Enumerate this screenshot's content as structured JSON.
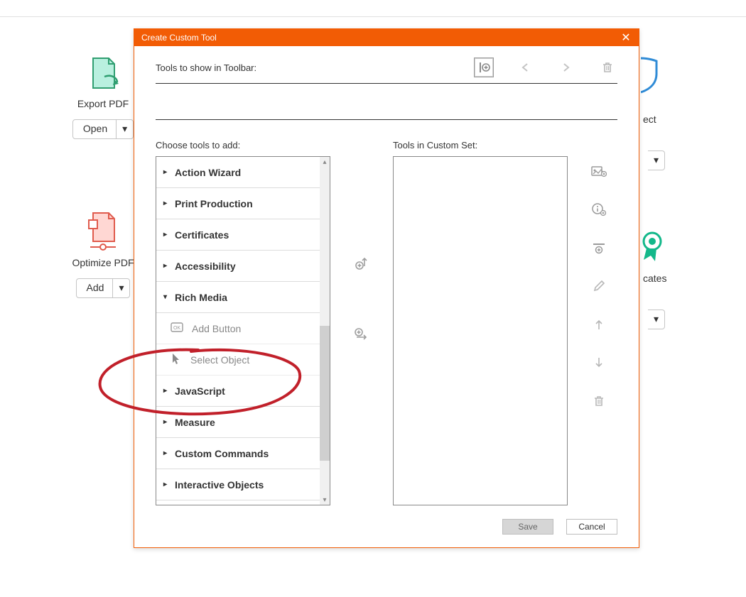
{
  "background": {
    "tools": [
      {
        "label": "Export PDF",
        "button": "Open"
      },
      {
        "label": "Optimize PDF",
        "button": "Add"
      }
    ],
    "right_labels": [
      "ect",
      "cates"
    ]
  },
  "dialog": {
    "title": "Create Custom Tool",
    "toolbar_label": "Tools to show in Toolbar:",
    "choose_label": "Choose tools to add:",
    "custom_label": "Tools in Custom Set:",
    "categories": [
      {
        "label": "Action Wizard",
        "expanded": false
      },
      {
        "label": "Print Production",
        "expanded": false
      },
      {
        "label": "Certificates",
        "expanded": false
      },
      {
        "label": "Accessibility",
        "expanded": false
      },
      {
        "label": "Rich Media",
        "expanded": true,
        "items": [
          "Add Button",
          "Select Object"
        ]
      },
      {
        "label": "JavaScript",
        "expanded": false
      },
      {
        "label": "Measure",
        "expanded": false
      },
      {
        "label": "Custom Commands",
        "expanded": false
      },
      {
        "label": "Interactive Objects",
        "expanded": false
      }
    ],
    "buttons": {
      "save": "Save",
      "cancel": "Cancel"
    }
  }
}
